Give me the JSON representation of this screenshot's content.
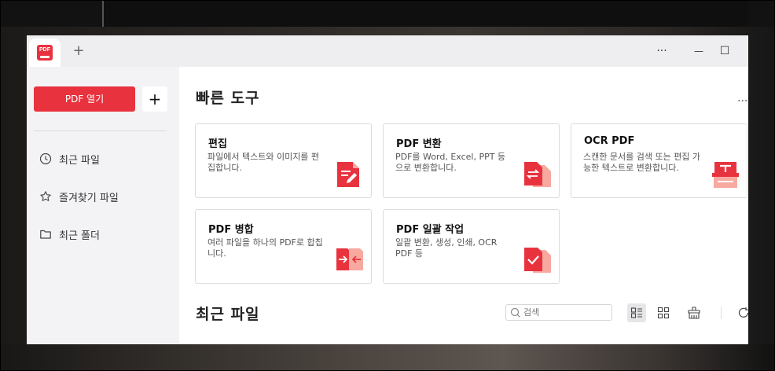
{
  "titlebar": {
    "tab_icon": "pdf-logo-icon",
    "logo_text": "PDF",
    "new_tab_label": "+",
    "more_label": "···",
    "minimize_label": "—",
    "maximize_label": "☐"
  },
  "sidebar": {
    "open_pdf_label": "PDF 열기",
    "add_label": "+",
    "items": [
      {
        "label": "최근 파일",
        "icon": "clock-icon"
      },
      {
        "label": "즐겨찾기 파일",
        "icon": "star-icon"
      },
      {
        "label": "최근 폴더",
        "icon": "folder-icon"
      }
    ]
  },
  "main": {
    "quick_tools_title": "빠른 도구",
    "more_label": "···",
    "cards": [
      {
        "title": "편집",
        "desc": "파일에서 텍스트와 이미지를 편집합니다.",
        "icon": "edit-icon"
      },
      {
        "title": "PDF 변환",
        "desc": "PDF를 Word, Excel, PPT 등으로 변환합니다.",
        "icon": "convert-icon"
      },
      {
        "title": "OCR PDF",
        "desc": "스캔한 문서를 검색 또는 편집 가능한 텍스트로 변환합니다.",
        "icon": "ocr-icon"
      },
      {
        "title": "PDF 병합",
        "desc": "여러 파일을 하나의 PDF로 합칩니다.",
        "icon": "merge-icon"
      },
      {
        "title": "PDF 일괄 작업",
        "desc": "일괄 변환, 생성, 인쇄, OCR PDF 등",
        "icon": "batch-icon"
      }
    ],
    "recent_title": "최근 파일",
    "search_placeholder": "검색"
  },
  "colors": {
    "accent": "#e8333f",
    "icon_light": "#f7a9a0"
  }
}
